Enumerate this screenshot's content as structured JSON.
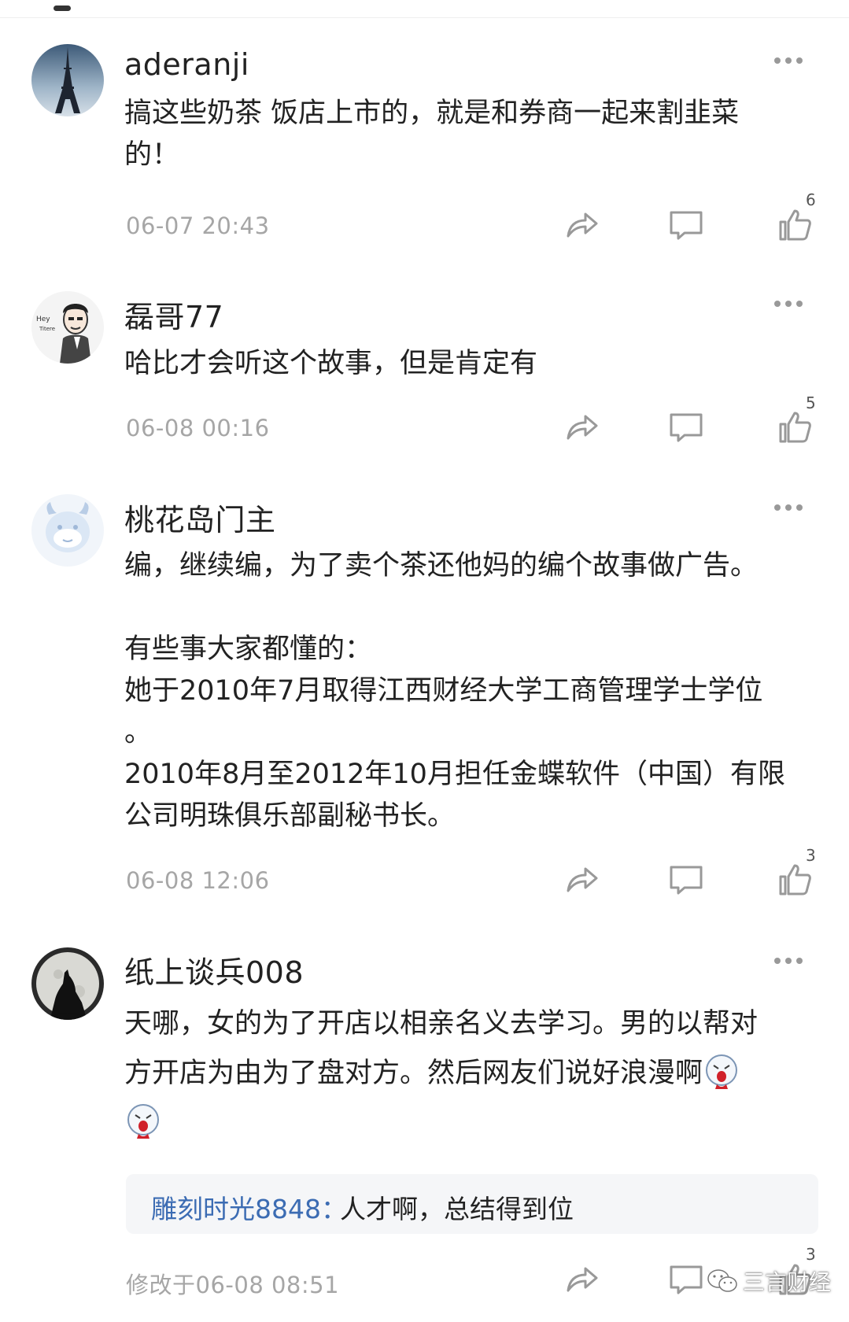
{
  "comments": [
    {
      "username": "aderanji",
      "text": "搞这些奶茶 饭店上市的，就是和券商一起来割韭菜\n的！",
      "time": "06-07 20:43",
      "likes": "6",
      "avatar": "eiffel-tower-avatar"
    },
    {
      "username": "磊哥77",
      "text": "哈比才会听这个故事，但是肯定有",
      "time": "06-08 00:16",
      "likes": "5",
      "avatar": "cartoon-man-avatar",
      "avatar_text_1": "Hey",
      "avatar_text_2": "Titere"
    },
    {
      "username": "桃花岛门主",
      "text": "编，继续编，为了卖个茶还他妈的编个故事做广告。\n\n有些事大家都懂的：\n她于2010年7月取得江西财经大学工商管理学士学位\n。\n2010年8月至2012年10月担任金蝶软件（中国）有限\n公司明珠俱乐部副秘书长。",
      "time": "06-08 12:06",
      "likes": "3",
      "avatar": "default-cow-avatar"
    },
    {
      "username": "纸上谈兵008",
      "text_line1": "天哪，女的为了开店以相亲名义去学习。男的以帮对",
      "text_line2": "方开店为由为了盘对方。然后网友们说好浪漫啊",
      "emoji": "vomit-blood-emoji",
      "reply": {
        "user": "雕刻时光8848",
        "separator": "：",
        "text": "人才啊，总结得到位"
      },
      "time": "修改于06-08 08:51",
      "likes": "3",
      "avatar": "wolf-moon-avatar"
    }
  ],
  "watermark": "三言财经",
  "colors": {
    "text": "#222222",
    "meta": "#a6a6a6",
    "link": "#3c6cb3",
    "icon": "#999999"
  }
}
